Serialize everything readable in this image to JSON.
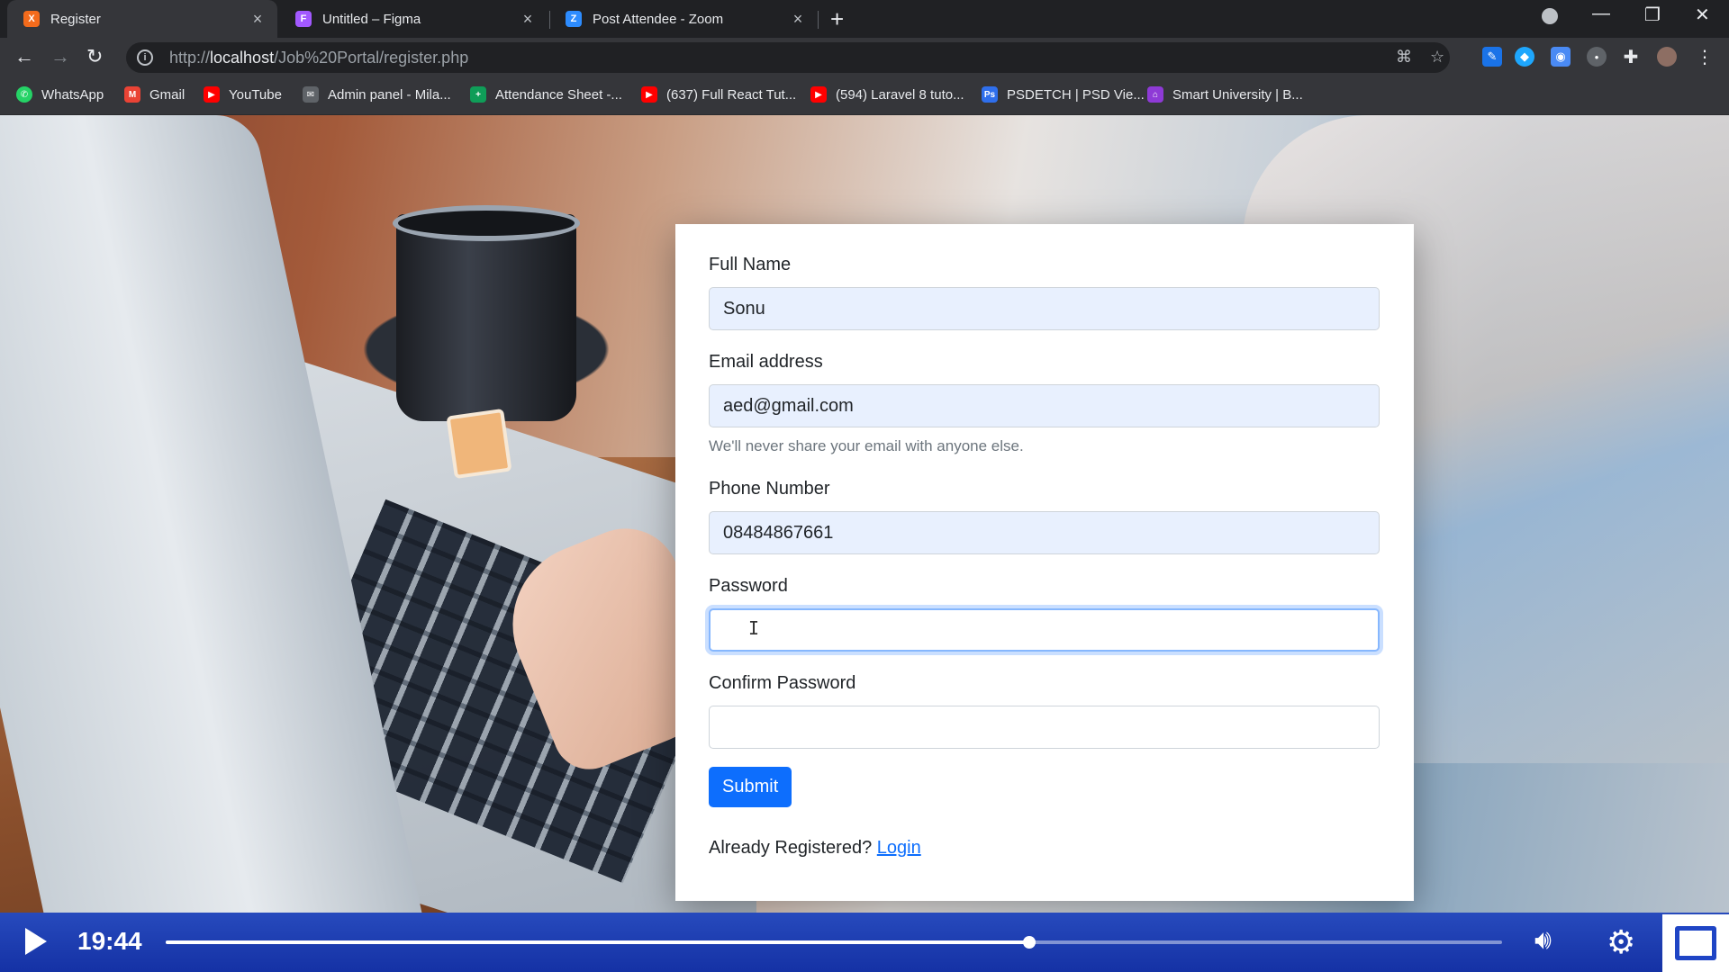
{
  "browser": {
    "tabs": [
      {
        "title": "Register",
        "favicon_color": "#f36b1c",
        "favicon_glyph": "X",
        "active": true
      },
      {
        "title": "Untitled – Figma",
        "favicon_color": "#a259ff",
        "favicon_glyph": "F",
        "active": false
      },
      {
        "title": "Post Attendee - Zoom",
        "favicon_color": "#2d8cff",
        "favicon_glyph": "Z",
        "active": false
      }
    ],
    "address": {
      "prefix": "http://",
      "host": "localhost",
      "path": "/Job%20Portal/register.php"
    },
    "bookmarks": [
      {
        "label": "WhatsApp",
        "icon": "whatsapp-icon",
        "color": "#25d366"
      },
      {
        "label": "Gmail",
        "icon": "gmail-icon",
        "color": "#ea4335"
      },
      {
        "label": "YouTube",
        "icon": "youtube-icon",
        "color": "#ff0000"
      },
      {
        "label": "Admin panel - Mila...",
        "icon": "mail-icon",
        "color": "#5f6368"
      },
      {
        "label": "Attendance Sheet -...",
        "icon": "sheets-icon",
        "color": "#0f9d58"
      },
      {
        "label": "(637) Full React Tut...",
        "icon": "youtube-icon",
        "color": "#ff0000"
      },
      {
        "label": "(594) Laravel 8 tuto...",
        "icon": "youtube-icon",
        "color": "#ff0000"
      },
      {
        "label": "PSDETCH | PSD Vie...",
        "icon": "psdetch-icon",
        "color": "#2f6fec"
      },
      {
        "label": "Smart University | B...",
        "icon": "university-icon",
        "color": "#8e3ad6"
      }
    ]
  },
  "form": {
    "full_name": {
      "label": "Full Name",
      "value": "Sonu"
    },
    "email": {
      "label": "Email address",
      "value": "aed@gmail.com",
      "help": "We'll never share your email with anyone else."
    },
    "phone": {
      "label": "Phone Number",
      "value": "08484867661"
    },
    "password": {
      "label": "Password",
      "value": ""
    },
    "confirm_password": {
      "label": "Confirm Password",
      "value": ""
    },
    "submit_label": "Submit",
    "already_text": "Already Registered?",
    "login_link": "Login"
  },
  "player": {
    "time": "19:44",
    "progress": 0.646
  },
  "colors": {
    "primary": "#0d6efd",
    "autofill_bg": "#e8f0fe",
    "player_bg": "#2447c8"
  }
}
